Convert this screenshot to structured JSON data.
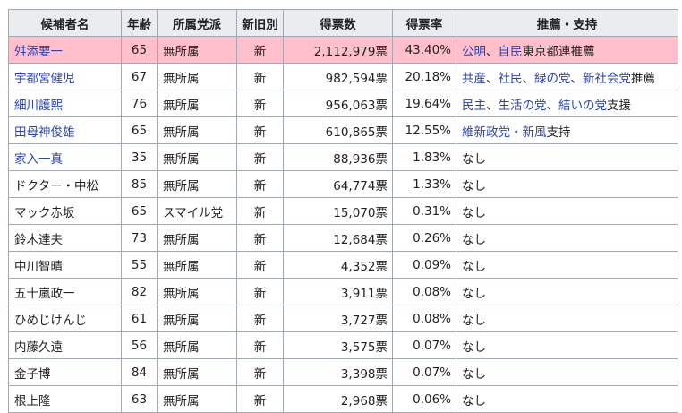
{
  "headers": [
    "候補者名",
    "年齢",
    "所属党派",
    "新旧別",
    "得票数",
    "得票率",
    "推薦・支持"
  ],
  "rows": [
    {
      "name": "舛添要一",
      "age": "65",
      "party": "無所属",
      "status": "新",
      "votes": "2,112,979票",
      "rate": "43.40%",
      "support": [
        {
          "text": "公明",
          "link": true
        },
        {
          "text": "、",
          "link": false
        },
        {
          "text": "自民",
          "link": true
        },
        {
          "text": "東京都連推薦",
          "link": false
        }
      ]
    },
    {
      "name": "宇都宮健児",
      "age": "67",
      "party": "無所属",
      "status": "新",
      "votes": "982,594票",
      "rate": "20.18%",
      "support": [
        {
          "text": "共産",
          "link": true
        },
        {
          "text": "、",
          "link": false
        },
        {
          "text": "社民",
          "link": true
        },
        {
          "text": "、",
          "link": false
        },
        {
          "text": "緑の党",
          "link": true
        },
        {
          "text": "、",
          "link": false
        },
        {
          "text": "新社会党",
          "link": true
        },
        {
          "text": "推薦",
          "link": false
        }
      ]
    },
    {
      "name": "細川護熙",
      "age": "76",
      "party": "無所属",
      "status": "新",
      "votes": "956,063票",
      "rate": "19.64%",
      "support": [
        {
          "text": "民主",
          "link": true
        },
        {
          "text": "、",
          "link": false
        },
        {
          "text": "生活の党",
          "link": true
        },
        {
          "text": "、",
          "link": false
        },
        {
          "text": "結いの党",
          "link": true
        },
        {
          "text": "支援",
          "link": false
        }
      ]
    },
    {
      "name": "田母神俊雄",
      "age": "65",
      "party": "無所属",
      "status": "新",
      "votes": "610,865票",
      "rate": "12.55%",
      "support": [
        {
          "text": "維新政党・新風",
          "link": true
        },
        {
          "text": "支持",
          "link": false
        }
      ]
    },
    {
      "name": "家入一真",
      "age": "35",
      "party": "無所属",
      "status": "新",
      "votes": "88,936票",
      "rate": "1.83%",
      "support": [
        {
          "text": "なし",
          "link": false
        }
      ]
    },
    {
      "name": "ドクター・中松",
      "age": "85",
      "party": "無所属",
      "status": "新",
      "votes": "64,774票",
      "rate": "1.33%",
      "support": [
        {
          "text": "なし",
          "link": false
        }
      ]
    },
    {
      "name": "マック赤坂",
      "age": "65",
      "party": "スマイル党",
      "status": "新",
      "votes": "15,070票",
      "rate": "0.31%",
      "support": [
        {
          "text": "なし",
          "link": false
        }
      ]
    },
    {
      "name": "鈴木達夫",
      "age": "73",
      "party": "無所属",
      "status": "新",
      "votes": "12,684票",
      "rate": "0.26%",
      "support": [
        {
          "text": "なし",
          "link": false
        }
      ]
    },
    {
      "name": "中川智晴",
      "age": "55",
      "party": "無所属",
      "status": "新",
      "votes": "4,352票",
      "rate": "0.09%",
      "support": [
        {
          "text": "なし",
          "link": false
        }
      ]
    },
    {
      "name": "五十嵐政一",
      "age": "82",
      "party": "無所属",
      "status": "新",
      "votes": "3,911票",
      "rate": "0.08%",
      "support": [
        {
          "text": "なし",
          "link": false
        }
      ]
    },
    {
      "name": "ひめじけんじ",
      "age": "61",
      "party": "無所属",
      "status": "新",
      "votes": "3,727票",
      "rate": "0.08%",
      "support": [
        {
          "text": "なし",
          "link": false
        }
      ]
    },
    {
      "name": "内藤久遠",
      "age": "56",
      "party": "無所属",
      "status": "新",
      "votes": "3,575票",
      "rate": "0.07%",
      "support": [
        {
          "text": "なし",
          "link": false
        }
      ]
    },
    {
      "name": "金子博",
      "age": "84",
      "party": "無所属",
      "status": "新",
      "votes": "3,398票",
      "rate": "0.07%",
      "support": [
        {
          "text": "なし",
          "link": false
        }
      ]
    },
    {
      "name": "根上隆",
      "age": "63",
      "party": "無所属",
      "status": "新",
      "votes": "2,968票",
      "rate": "0.06%",
      "support": [
        {
          "text": "なし",
          "link": false
        }
      ]
    }
  ],
  "name_links": [
    true,
    true,
    true,
    true,
    true,
    false,
    false,
    false,
    false,
    false,
    false,
    false,
    false,
    false
  ],
  "winner_row": 0,
  "colors": {
    "winner_bg": "#ffc0cb",
    "header_bg": "#eaecf0",
    "link": "#2a44b6",
    "border": "#a2a9b1"
  }
}
